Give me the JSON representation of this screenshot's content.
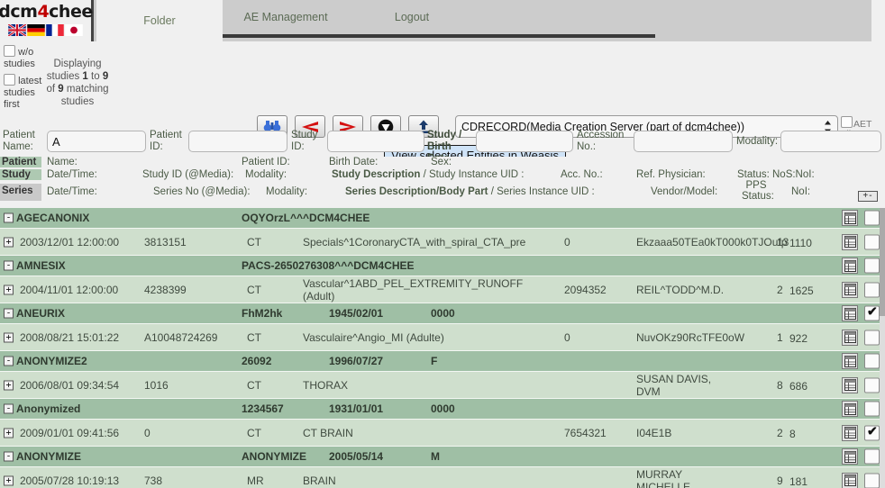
{
  "brand": {
    "name_a": "dcm",
    "name_4": "4",
    "name_b": "chee"
  },
  "tabs": [
    {
      "label": "Folder",
      "active": true
    },
    {
      "label": "AE Management",
      "active": false
    },
    {
      "label": "Logout",
      "active": false
    }
  ],
  "left_controls": {
    "wo_studies_label": "w/o studies",
    "latest_studies_label": "latest studies first",
    "displaying_pre": "Displaying studies ",
    "displaying_from": "1",
    "displaying_mid": " to ",
    "displaying_to": "9",
    "displaying_of": " of ",
    "displaying_total": "9",
    "displaying_post": " matching studies"
  },
  "toolbar": {
    "buttons": [
      {
        "name": "search-binoculars-icon",
        "title": "Search"
      },
      {
        "name": "previous-arrow-icon",
        "title": "Previous"
      },
      {
        "name": "next-arrow-icon",
        "title": "Next"
      },
      {
        "name": "download-circle-icon",
        "title": "Download"
      },
      {
        "name": "upload-icon",
        "title": "Upload"
      }
    ],
    "ae_selected": "CDRECORD(Media Creation Server (part of dcm4chee))",
    "aet_filter_label": "AET Filter",
    "tooltip": "View selected Entities in Weasis"
  },
  "search": {
    "patient_name_label": "Patient Name:",
    "patient_name_value": "A",
    "patient_id_label": "Patient ID:",
    "patient_id_value": "",
    "study_id_label": "Study ID:",
    "study_id_value": "",
    "study_birth_date_label": "Study / Birth Date",
    "study_birth_date_value": "",
    "accession_label": "Accession No.:",
    "accession_value": "",
    "modality_label": "Modality:",
    "modality_value": ""
  },
  "headers": {
    "patient_tag": "Patient",
    "patient_name": "Name:",
    "patient_id": "Patient ID:",
    "patient_birth": "Birth Date:",
    "patient_sex": "Sex:",
    "study_tag": "Study",
    "study_datetime": "Date/Time:",
    "study_id": "Study ID (@Media):",
    "study_modality": "Modality:",
    "study_desc": "Study Description",
    "study_desc_sep": " / Study Instance UID :",
    "study_acc": "Acc. No.:",
    "study_ref": "Ref. Physician:",
    "study_status": "Status: NoS:NoI:",
    "series_tag": "Series",
    "series_datetime": "Date/Time:",
    "series_no": "Series No (@Media):",
    "series_modality": "Modality:",
    "series_desc": "Series Description/Body Part",
    "series_desc_sep": " / Series Instance UID :",
    "series_vendor": "Vendor/Model:",
    "series_pps": "PPS Status:",
    "series_noi": "NoI:",
    "expand_collapse": "+-"
  },
  "rows": [
    {
      "type": "patient",
      "expander": "-",
      "name": "AGECANONIX",
      "pid": "OQYOrzL^^^DCM4CHEE",
      "birth": "",
      "sex": "",
      "checked": false
    },
    {
      "type": "study",
      "expander": "+",
      "datetime": "2003/12/01 12:00:00",
      "study_id": "3813151",
      "modality": "CT",
      "desc": "Specials^1CoronaryCTA_with_spiral_CTA_pre",
      "acc": "0",
      "ref": "Ekzaaa50TEa0kT000k0TJOufp",
      "nos": "13",
      "noi": "1110",
      "checked": false
    },
    {
      "type": "patient",
      "expander": "-",
      "name": "AMNESIX",
      "pid": "PACS-2650276308^^^DCM4CHEE",
      "birth": "",
      "sex": "",
      "checked": false
    },
    {
      "type": "study",
      "expander": "+",
      "datetime": "2004/11/01 12:00:00",
      "study_id": "4238399",
      "modality": "CT",
      "desc": "Vascular^1ABD_PEL_EXTREMITY_RUNOFF (Adult)",
      "acc": "2094352",
      "ref": "REIL^TODD^M.D.",
      "nos": "2",
      "noi": "1625",
      "checked": false
    },
    {
      "type": "patient",
      "expander": "-",
      "name": "ANEURIX",
      "pid": "FhM2hk",
      "birth": "1945/02/01",
      "sex": "0000",
      "checked": true
    },
    {
      "type": "study",
      "expander": "+",
      "datetime": "2008/08/21 15:01:22",
      "study_id": "A10048724269",
      "modality": "CT",
      "desc": "Vasculaire^Angio_MI (Adulte)",
      "acc": "0",
      "ref": "NuvOKz90RcTFE0oW",
      "nos": "1",
      "noi": "922",
      "checked": false
    },
    {
      "type": "patient",
      "expander": "-",
      "name": "ANONYMIZE2",
      "pid": "26092",
      "birth": "1996/07/27",
      "sex": "F",
      "checked": false
    },
    {
      "type": "study",
      "expander": "+",
      "datetime": "2006/08/01 09:34:54",
      "study_id": "1016",
      "modality": "CT",
      "desc": "THORAX",
      "acc": "",
      "ref": "SUSAN DAVIS, DVM",
      "nos": "8",
      "noi": "686",
      "checked": false
    },
    {
      "type": "patient",
      "expander": "-",
      "name": "Anonymized",
      "pid": "1234567",
      "birth": "1931/01/01",
      "sex": "0000",
      "checked": false
    },
    {
      "type": "study",
      "expander": "+",
      "datetime": "2009/01/01 09:41:56",
      "study_id": "0",
      "modality": "CT",
      "desc": "CT BRAIN",
      "acc": "7654321",
      "ref": "I04E1B",
      "nos": "2",
      "noi": "8",
      "checked": true
    },
    {
      "type": "patient",
      "expander": "-",
      "name": "ANONYMIZE",
      "pid": "ANONYMIZE",
      "birth": "2005/05/14",
      "sex": "M",
      "checked": false
    },
    {
      "type": "study",
      "expander": "+",
      "datetime": "2005/07/28 10:19:13",
      "study_id": "738",
      "modality": "MR",
      "desc": "BRAIN",
      "acc": "",
      "ref": "MURRAY MICHELLE",
      "nos": "9",
      "noi": "181",
      "checked": false
    }
  ],
  "colors": {
    "patient_row": "#9fbfa5",
    "study_row": "#cfdfcd",
    "tooltip_bg": "#cfe3f7",
    "chrome": "#f0f0f0",
    "tabbar": "#cccccc",
    "accent_red": "#c00000"
  }
}
